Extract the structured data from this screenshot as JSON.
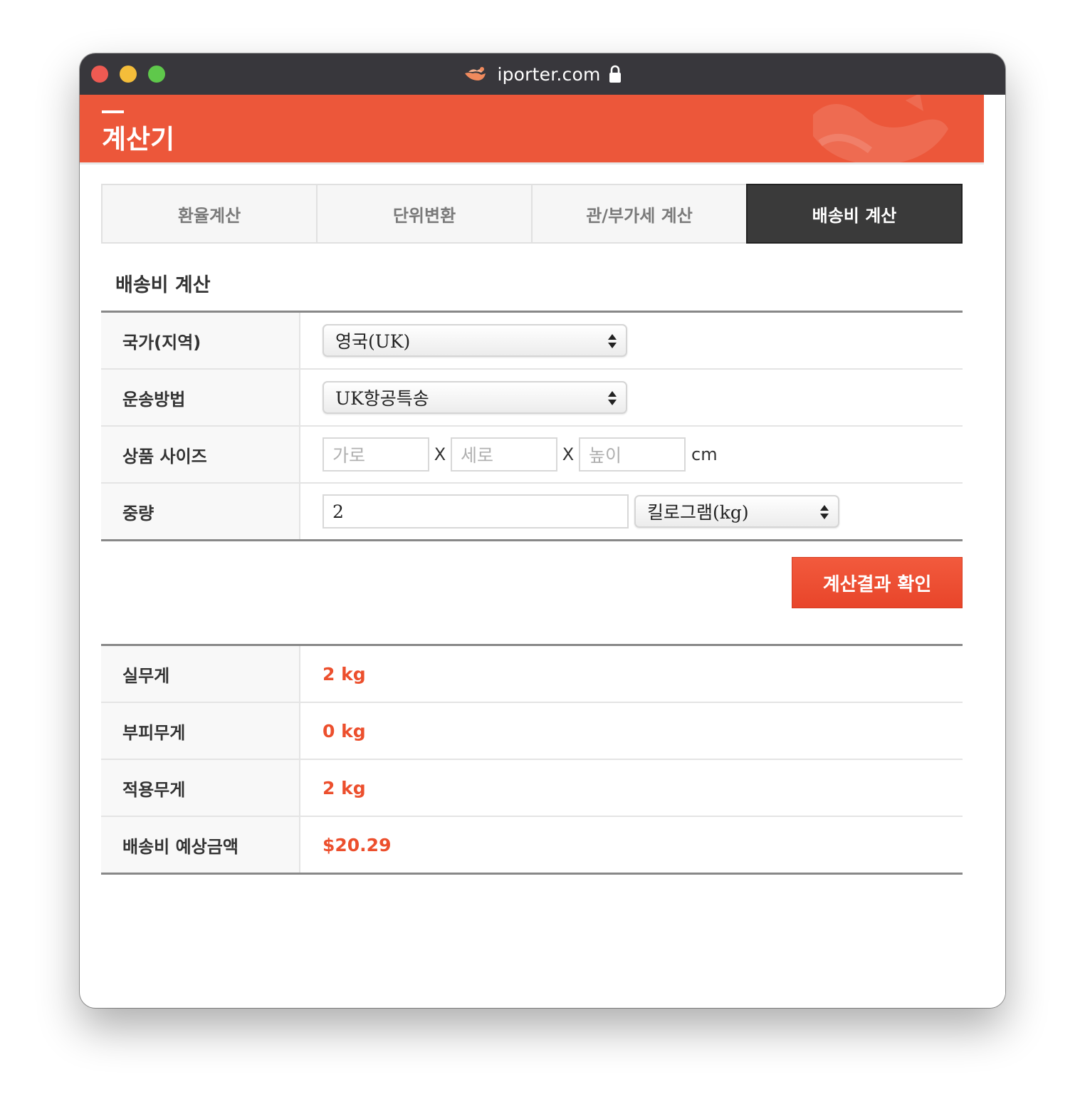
{
  "browser": {
    "url": "iporter.com"
  },
  "banner": {
    "title": "계산기"
  },
  "tabs": [
    {
      "label": "환율계산",
      "active": false
    },
    {
      "label": "단위변환",
      "active": false
    },
    {
      "label": "관/부가세 계산",
      "active": false
    },
    {
      "label": "배송비 계산",
      "active": true
    }
  ],
  "section": {
    "title": "배송비 계산"
  },
  "form": {
    "country": {
      "label": "국가(지역)",
      "selected": "영국(UK)"
    },
    "shipping": {
      "label": "운송방법",
      "selected": "UK항공특송"
    },
    "size": {
      "label": "상품 사이즈",
      "width_placeholder": "가로",
      "length_placeholder": "세로",
      "height_placeholder": "높이",
      "separator": "X",
      "unit": "cm"
    },
    "weight": {
      "label": "중량",
      "value": "2",
      "unit_selected": "킬로그램(kg)"
    }
  },
  "calc_button": {
    "label": "계산결과 확인"
  },
  "results": [
    {
      "label": "실무게",
      "value": "2 kg"
    },
    {
      "label": "부피무게",
      "value": "0 kg"
    },
    {
      "label": "적용무게",
      "value": "2 kg"
    },
    {
      "label": "배송비 예상금액",
      "value": "$20.29"
    }
  ],
  "colors": {
    "accent": "#ec573a",
    "result_text": "#ec4f2d",
    "active_tab": "#3a3a3a",
    "titlebar": "#38373c"
  }
}
